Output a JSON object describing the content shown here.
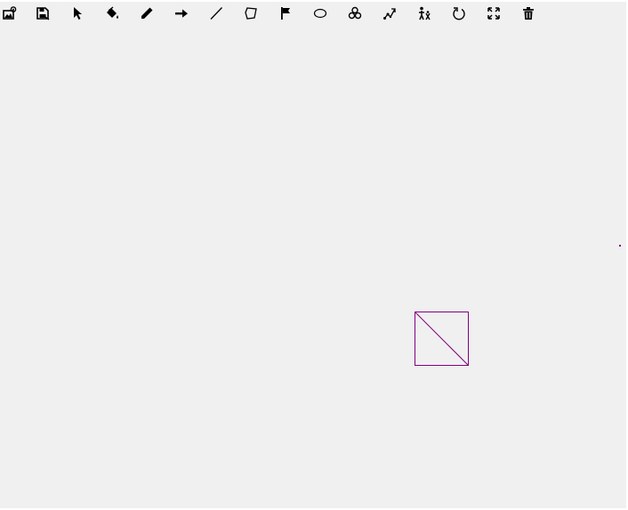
{
  "toolbar": {
    "tools": [
      {
        "name": "open-image",
        "icon": "image-open-icon"
      },
      {
        "name": "save",
        "icon": "floppy-save-icon"
      },
      {
        "name": "select",
        "icon": "pointer-icon"
      },
      {
        "name": "fill",
        "icon": "paint-bucket-icon"
      },
      {
        "name": "pencil",
        "icon": "pencil-icon"
      },
      {
        "name": "arrow",
        "icon": "arrow-right-icon"
      },
      {
        "name": "line",
        "icon": "line-icon"
      },
      {
        "name": "polygon",
        "icon": "polygon-icon"
      },
      {
        "name": "flag",
        "icon": "flag-icon"
      },
      {
        "name": "ellipse",
        "icon": "ellipse-icon"
      },
      {
        "name": "triangle-circles",
        "icon": "triangle-circles-icon"
      },
      {
        "name": "path",
        "icon": "path-icon"
      },
      {
        "name": "figure",
        "icon": "figure-walk-icon"
      },
      {
        "name": "undo",
        "icon": "rotate-icon"
      },
      {
        "name": "fullscreen",
        "icon": "expand-icon"
      },
      {
        "name": "delete",
        "icon": "trash-icon"
      }
    ]
  },
  "canvas": {
    "background": "#f0f0f0",
    "stroke_color": "#800080"
  }
}
